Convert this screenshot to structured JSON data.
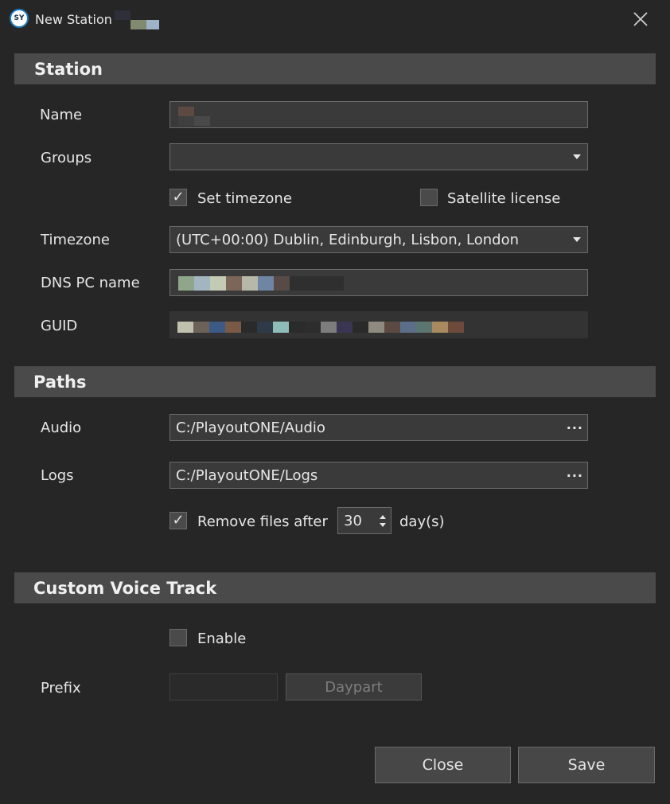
{
  "window": {
    "title": "New Station",
    "logo_text": "SY",
    "close_icon": "close-icon"
  },
  "station": {
    "header": "Station",
    "name_label": "Name",
    "groups_label": "Groups",
    "set_timezone_label": "Set timezone",
    "set_timezone_checked": true,
    "satellite_license_label": "Satellite license",
    "satellite_license_checked": false,
    "timezone_label": "Timezone",
    "timezone_value": "(UTC+00:00) Dublin, Edinburgh, Lisbon, London",
    "dns_label": "DNS PC name",
    "guid_label": "GUID"
  },
  "paths": {
    "header": "Paths",
    "audio_label": "Audio",
    "audio_value": "C:/PlayoutONE/Audio",
    "logs_label": "Logs",
    "logs_value": "C:/PlayoutONE/Logs",
    "remove_files_label": "Remove files after",
    "remove_files_checked": true,
    "days_value": "30",
    "days_unit": "day(s)"
  },
  "voice_track": {
    "header": "Custom Voice Track",
    "enable_label": "Enable",
    "enable_checked": false,
    "prefix_label": "Prefix",
    "daypart_button": "Daypart"
  },
  "footer": {
    "close_button": "Close",
    "save_button": "Save"
  },
  "colors": {
    "background": "#262626",
    "section_header": "#4a4a4a",
    "field_bg": "#3a3a3a",
    "border": "#6a6a6a",
    "text": "#e6e6e6",
    "logo_ring": "#1b79c4"
  }
}
